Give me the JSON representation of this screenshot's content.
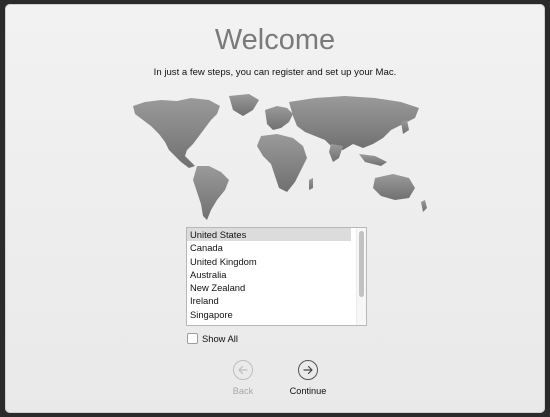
{
  "welcome": {
    "title": "Welcome",
    "subtitle": "In just a few steps, you can register and set up your Mac."
  },
  "country_list": {
    "items": [
      "United States",
      "Canada",
      "United Kingdom",
      "Australia",
      "New Zealand",
      "Ireland",
      "Singapore"
    ],
    "selected": "United States"
  },
  "show_all": {
    "label": "Show All",
    "checked": false
  },
  "nav": {
    "back_label": "Back",
    "back_icon": "arrow-left-icon",
    "continue_label": "Continue",
    "continue_icon": "arrow-right-icon"
  },
  "colors": {
    "map": "#8a8a8a",
    "title": "#7a7a7a",
    "selection": "#dcdcdc"
  }
}
